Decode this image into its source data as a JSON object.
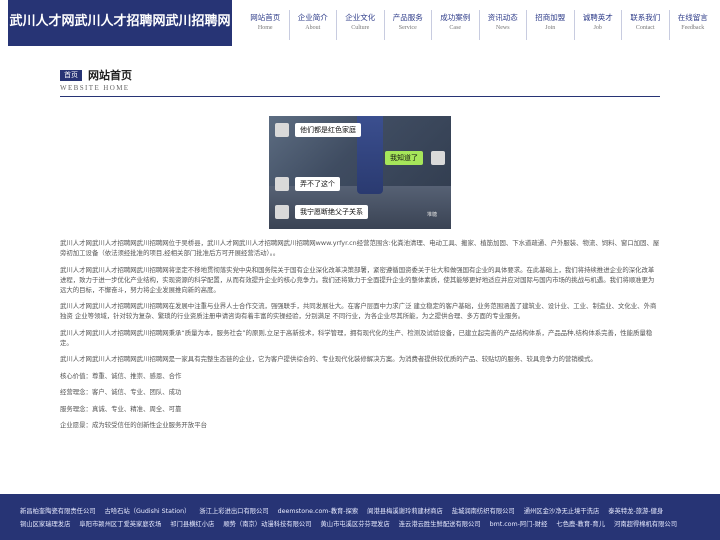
{
  "header": {
    "logo": "武川人才网武川人才招聘网武川招聘网",
    "nav": [
      {
        "cn": "网站首页",
        "en": "Home"
      },
      {
        "cn": "企业简介",
        "en": "About"
      },
      {
        "cn": "企业文化",
        "en": "Culture"
      },
      {
        "cn": "产品服务",
        "en": "Service"
      },
      {
        "cn": "成功案例",
        "en": "Case"
      },
      {
        "cn": "资讯动态",
        "en": "News"
      },
      {
        "cn": "招商加盟",
        "en": "Join"
      },
      {
        "cn": "诚聘英才",
        "en": "Job"
      },
      {
        "cn": "联系我们",
        "en": "Contact"
      },
      {
        "cn": "在线留言",
        "en": "Feedback"
      }
    ]
  },
  "page": {
    "badge": "首页",
    "title": "网站首页",
    "subtitle": "WEBSITE HOME"
  },
  "photo": {
    "bubbles": [
      "他们都是红色家庭",
      "我知道了",
      "弄不了这个",
      "我宁愿断绝父子关系"
    ],
    "watermark": "堆糖"
  },
  "content": {
    "paragraphs": [
      "武川人才网武川人才招聘网武川招聘网位于吴桥县，武川人才网武川人才招聘网武川招聘网www.yrfyr.cn经营范围含:化粪池清理、电动工具、搬家、植筋加固、下水道疏通、户外服装、物流、饲料、窗口加固、屋旁初加工设备（依法须经批准的项目,经相关部门批准后方可开展经营活动）。。",
      "武川人才网武川人才招聘网武川招聘网将坚定不移地贯彻落实党中央和国务院关于国有企业深化改革决策部署，紧密遵循国资委关于壮大和做强国有企业的具体要求。在此基础上，我们将持续推进企业的深化改革进程，致力于进一步优化产业结构，实现资源的科学配置，从而有效提升企业的核心竞争力。我们还将致力于全面提升企业的整体素质，使其能够更好地适应并应对国际与国内市场的挑战与机遇。我们将顺准更为远大的目标，不懈奋斗，努力将企业发展推向新的高度。",
      "武川人才网武川人才招聘网武川招聘网在发展中注重与业界人士合作交流，强强联手，共同发展壮大。在客户层面中力求广泛 建立稳定的客户基础，业务范围涵盖了建筑业、设计业、工业、制造业、文化业、外商独资 企业等领域，针对较为复杂、繁琐的行业资质注册申请咨询有着丰富的实操经验，分别满足 不同行业，为各企业尽其所能，为之提供合理、多方面的专业服务。",
      "武川人才网武川人才招聘网武川招聘网秉承“质量为本，服务社会”的原则,立足于高新技术，科学管理，拥有现代化的生产、检测及试验设备，已建立起完善的产品结构体系，产品品种,结构体系完善，性能质量稳定。",
      "武川人才网武川人才招聘网武川招聘网是一家具有完整生态链的企业，它为客户提供综合的、专业现代化装修解决方案。为消费者提供较优质的产品、较贴切的服务、较具竞争力的营销模式。",
      "核心价值：尊重、诚信、推崇、感恩、合作",
      "经营理念：客户、诚信、专业、团队、成功",
      "服务理念：真诚、专业、精准、周全、可靠",
      "企业愿景：成为较受信任的创新性企业服务开放平台"
    ]
  },
  "footer": {
    "links": [
      "新昌柏奎陶瓷有限责任公司",
      "古哈石站（Gudishi Station）",
      "浙江上彩进出口有限公司",
      "deemstone.com-教育-探索",
      "阆港县梅溪谢玲莉建材商店",
      "盐城润南纺织有限公司",
      "通州区金沙净无止境干洗店",
      "泰英特龙-旅游-健身",
      "铜山区家瑞理发店",
      "阜阳市颍州区丁爱英家庭农场",
      "祁门县横红小店",
      "顺势（南京）动漫科技有限公司",
      "黄山市屯溪区芬芬理发店",
      "连云港云胜生鲜配送有限公司",
      "bmt.com-阿门-财经",
      "七色鹿-教育-育儿",
      "河南超得棉机有限公司"
    ]
  },
  "colors": {
    "brand": "#273475",
    "bubble_green": "#a6e65a"
  }
}
